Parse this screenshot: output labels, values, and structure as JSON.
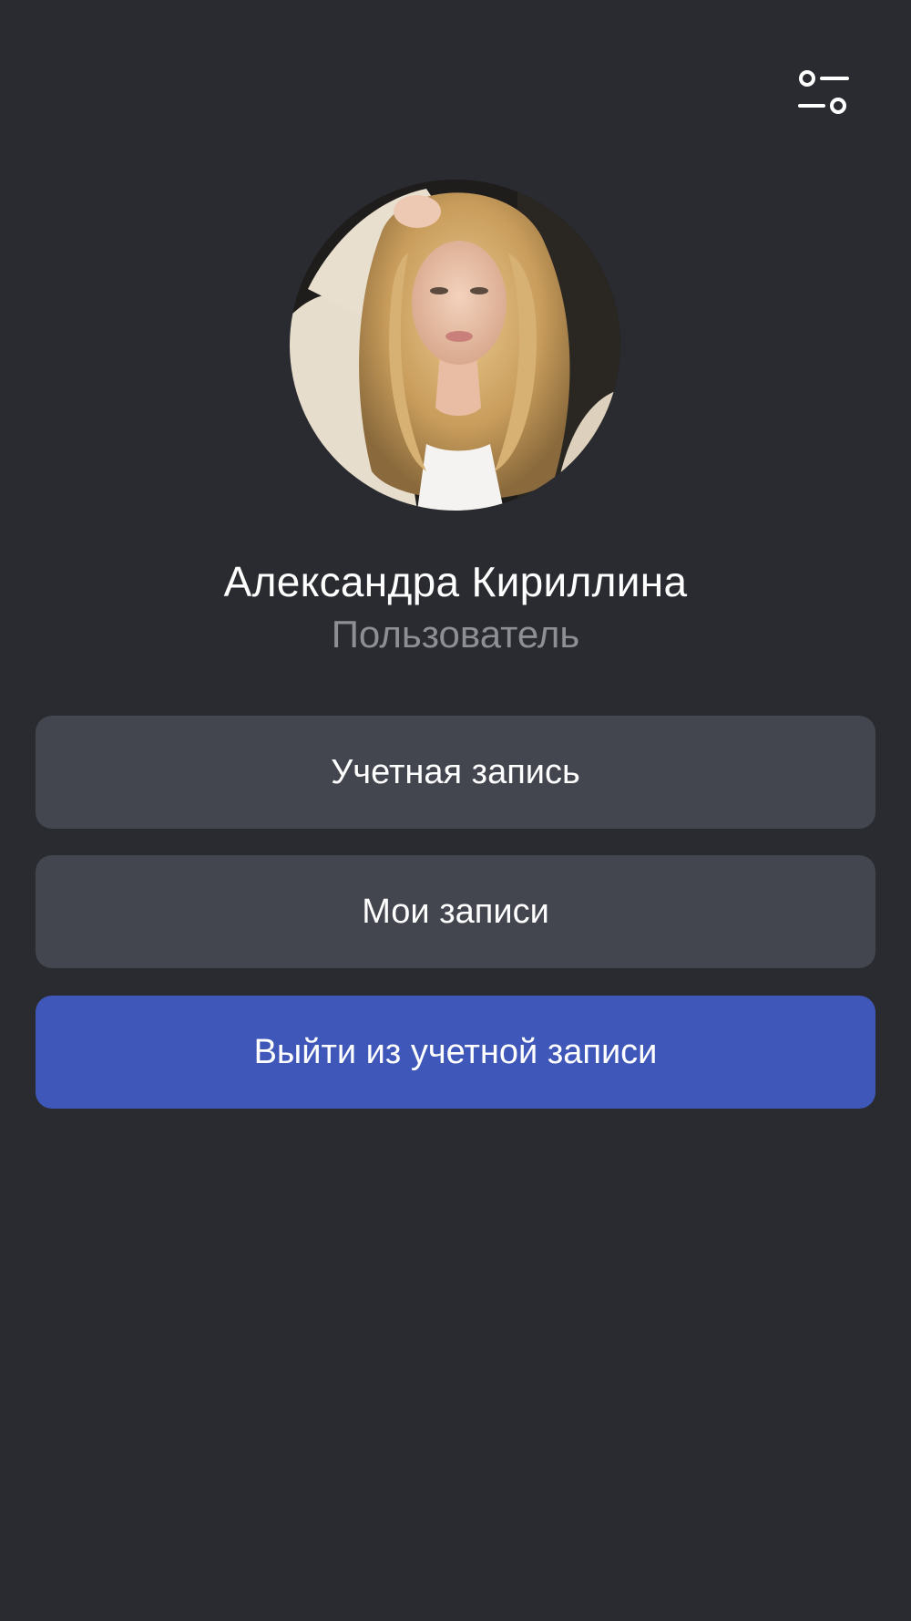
{
  "header": {
    "settings_icon": "settings-sliders-icon"
  },
  "profile": {
    "avatar_alt": "avatar",
    "name": "Александра Кириллина",
    "role": "Пользователь"
  },
  "menu": {
    "account_label": "Учетная запись",
    "my_records_label": "Мои записи",
    "logout_label": "Выйти из учетной записи"
  },
  "colors": {
    "background": "#292b30",
    "button": "#43454f",
    "primary_button": "#3f57b8",
    "secondary_text": "#8e8f94"
  }
}
